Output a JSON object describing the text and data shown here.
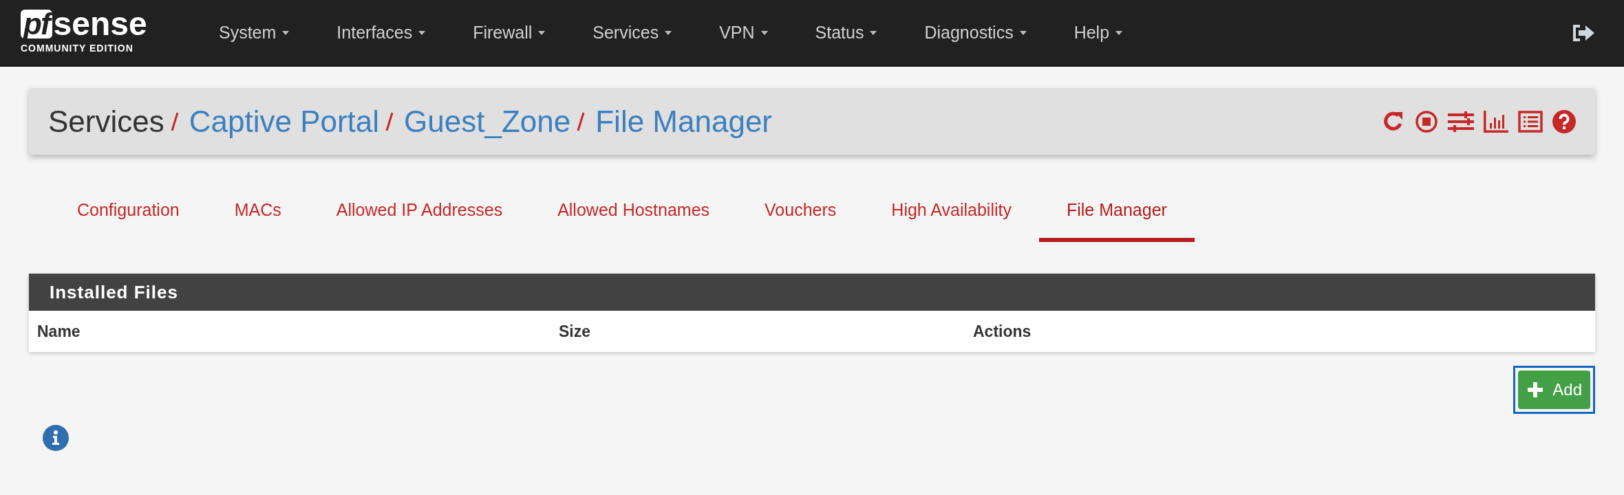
{
  "brand": {
    "mark": "pf",
    "name": "sense",
    "edition": "COMMUNITY EDITION"
  },
  "nav": [
    {
      "label": "System",
      "caret": true
    },
    {
      "label": "Interfaces",
      "caret": true
    },
    {
      "label": "Firewall",
      "caret": true
    },
    {
      "label": "Services",
      "caret": true
    },
    {
      "label": "VPN",
      "caret": true
    },
    {
      "label": "Status",
      "caret": true
    },
    {
      "label": "Diagnostics",
      "caret": true
    },
    {
      "label": "Help",
      "caret": true
    }
  ],
  "breadcrumb": [
    {
      "label": "Services",
      "link": false
    },
    {
      "label": "Captive Portal",
      "link": true
    },
    {
      "label": "Guest_Zone",
      "link": true
    },
    {
      "label": "File Manager",
      "link": true
    }
  ],
  "tabs": [
    {
      "label": "Configuration",
      "selected": false
    },
    {
      "label": "MACs",
      "selected": false
    },
    {
      "label": "Allowed IP Addresses",
      "selected": false
    },
    {
      "label": "Allowed Hostnames",
      "selected": false
    },
    {
      "label": "Vouchers",
      "selected": false
    },
    {
      "label": "High Availability",
      "selected": false
    },
    {
      "label": "File Manager",
      "selected": true
    }
  ],
  "panel": {
    "title": "Installed Files",
    "columns": [
      "Name",
      "Size",
      "Actions"
    ]
  },
  "add_button": {
    "label": "Add",
    "focused": true
  }
}
